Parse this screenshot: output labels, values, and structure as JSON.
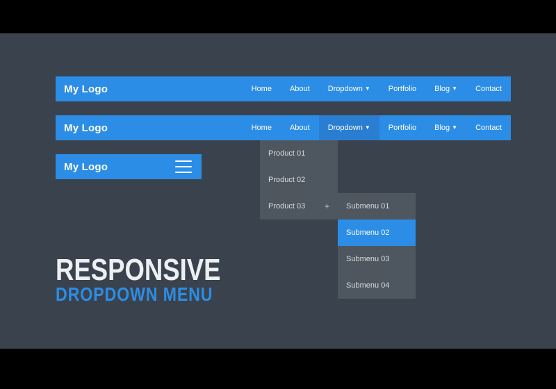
{
  "colors": {
    "bg_outer": "#000000",
    "bg_stage": "#3a424d",
    "accent": "#2c8de6",
    "accent_active": "#2a7ed1",
    "panel": "#4e565f",
    "text_light": "#ecf0f3",
    "text_muted": "#d9dcdf"
  },
  "logo": "My Logo",
  "nav": {
    "items": [
      {
        "label": "Home"
      },
      {
        "label": "About"
      },
      {
        "label": "Dropdown",
        "caret": true
      },
      {
        "label": "Portfolio"
      },
      {
        "label": "Blog",
        "caret": true
      },
      {
        "label": "Contact"
      }
    ],
    "active_index_bar2": 2
  },
  "dropdown": {
    "items": [
      {
        "label": "Product 01"
      },
      {
        "label": "Product 02"
      },
      {
        "label": "Product 03",
        "expand": "+"
      }
    ]
  },
  "submenu": {
    "items": [
      {
        "label": "Submenu 01"
      },
      {
        "label": "Submenu 02",
        "highlight": true
      },
      {
        "label": "Submenu 03"
      },
      {
        "label": "Submenu 04"
      }
    ]
  },
  "title": {
    "main": "RESPONSIVE",
    "sub": "DROPDOWN MENU"
  }
}
